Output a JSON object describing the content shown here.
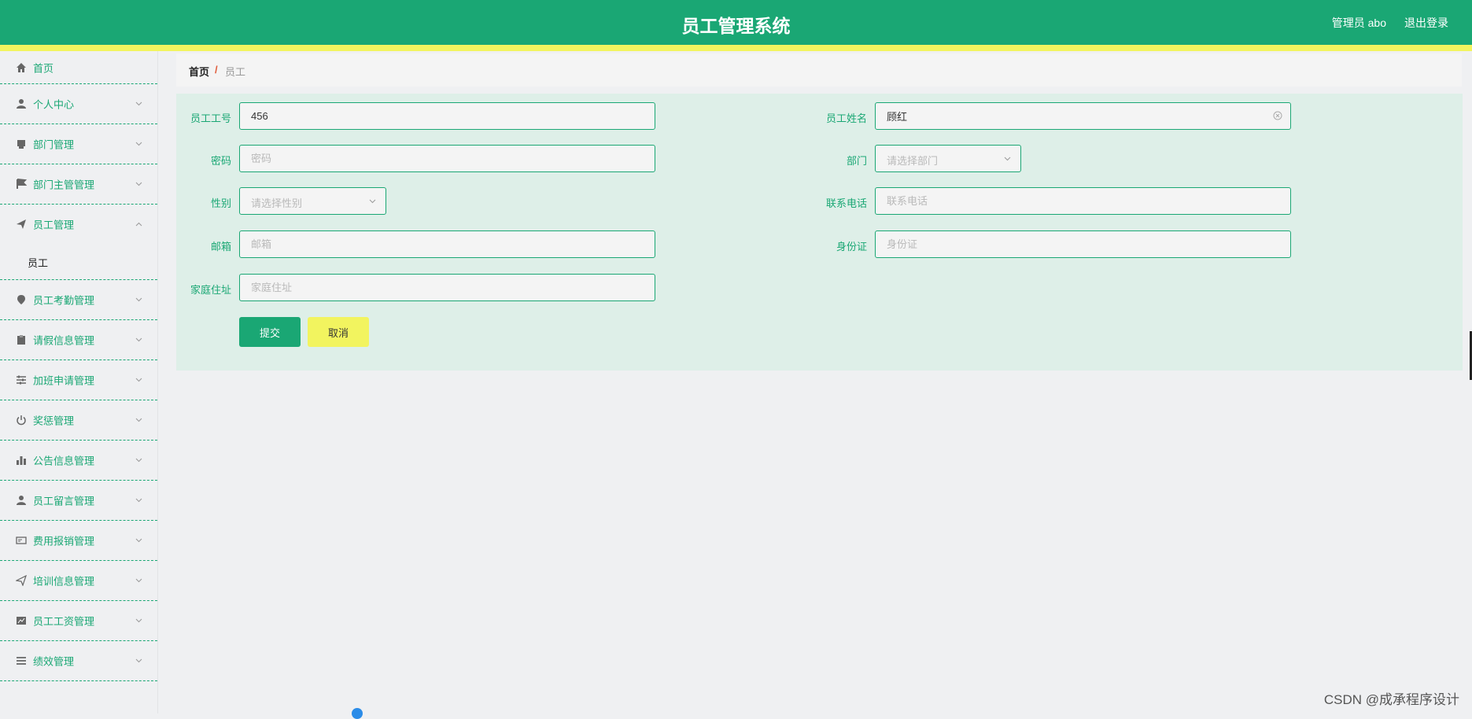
{
  "header": {
    "title": "员工管理系统",
    "user": "管理员 abo",
    "logout": "退出登录"
  },
  "sidebar": {
    "items": [
      {
        "label": "首页",
        "icon": "home-icon"
      },
      {
        "label": "个人中心",
        "icon": "user-icon"
      },
      {
        "label": "部门管理",
        "icon": "printer-icon"
      },
      {
        "label": "部门主管管理",
        "icon": "flag-icon"
      },
      {
        "label": "员工管理",
        "icon": "send-icon",
        "expanded": true,
        "children": [
          "员工"
        ]
      },
      {
        "label": "员工考勤管理",
        "icon": "location-icon"
      },
      {
        "label": "请假信息管理",
        "icon": "clipboard-icon"
      },
      {
        "label": "加班申请管理",
        "icon": "sliders-icon"
      },
      {
        "label": "奖惩管理",
        "icon": "power-icon"
      },
      {
        "label": "公告信息管理",
        "icon": "bar-chart-icon"
      },
      {
        "label": "员工留言管理",
        "icon": "user-icon"
      },
      {
        "label": "费用报销管理",
        "icon": "card-icon"
      },
      {
        "label": "培训信息管理",
        "icon": "paper-plane-icon"
      },
      {
        "label": "员工工资管理",
        "icon": "chart-icon"
      },
      {
        "label": "绩效管理",
        "icon": "list-icon"
      }
    ]
  },
  "breadcrumb": {
    "home": "首页",
    "sep": "/",
    "current": "员工"
  },
  "form": {
    "emp_no": {
      "label": "员工工号",
      "value": "456"
    },
    "emp_name": {
      "label": "员工姓名",
      "value": "顾红"
    },
    "password": {
      "label": "密码",
      "placeholder": "密码"
    },
    "department": {
      "label": "部门",
      "placeholder": "请选择部门"
    },
    "gender": {
      "label": "性别",
      "placeholder": "请选择性别"
    },
    "phone": {
      "label": "联系电话",
      "placeholder": "联系电话"
    },
    "email": {
      "label": "邮箱",
      "placeholder": "邮箱"
    },
    "id_card": {
      "label": "身份证",
      "placeholder": "身份证"
    },
    "address": {
      "label": "家庭住址",
      "placeholder": "家庭住址"
    },
    "submit": "提交",
    "cancel": "取消"
  },
  "colors": {
    "primary": "#1aa774",
    "accent_yellow": "#f2f45f",
    "panel_bg": "#deefe8"
  },
  "watermark": "CSDN @成承程序设计"
}
